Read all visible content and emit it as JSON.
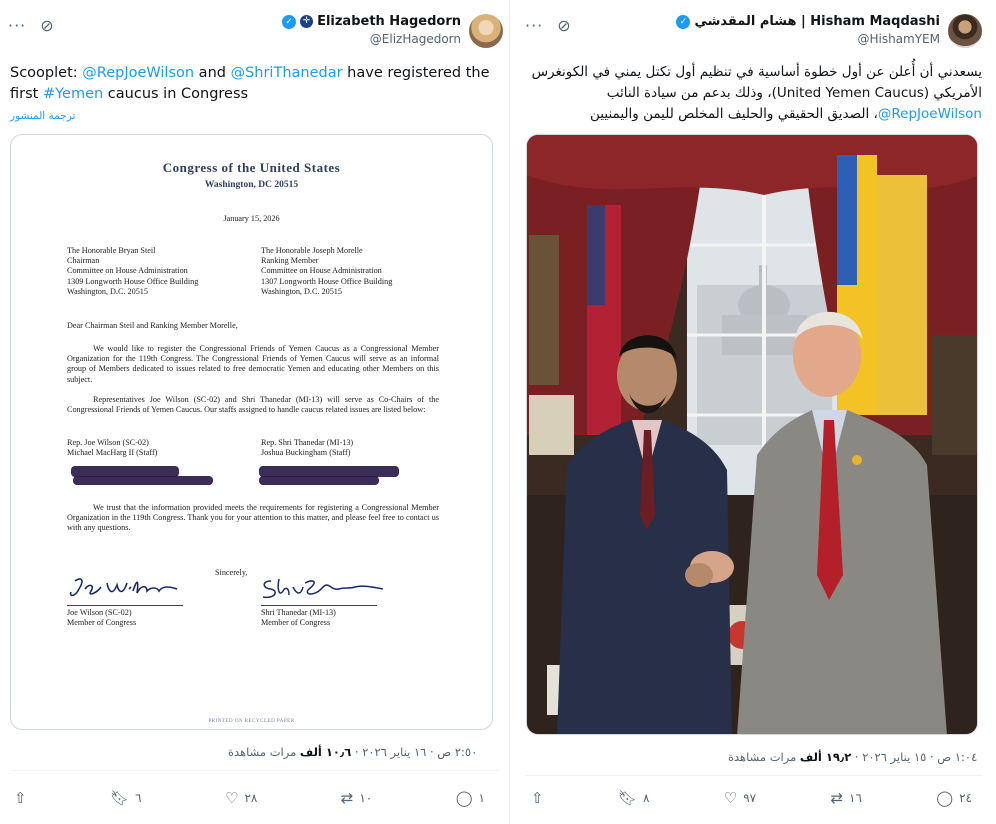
{
  "left": {
    "user": {
      "name": "Elizabeth Hagedorn",
      "handle": "@ElizHagedorn"
    },
    "text": {
      "prefix": "Scooplet: ",
      "mention1": "@RepJoeWilson",
      "mid1": " and ",
      "mention2": "@ShriThanedar",
      "mid2": " have registered the first ",
      "hashtag": "#Yemen",
      "suffix": " caucus in Congress"
    },
    "translate": "ترجمة المنشور",
    "letter": {
      "letterhead": "Congress of the United States",
      "city": "Washington, DC 20515",
      "date": "January 15, 2026",
      "addr1": [
        "The Honorable Bryan Steil",
        "Chairman",
        "Committee on House Administration",
        "1309 Longworth House Office Building",
        "Washington, D.C. 20515"
      ],
      "addr2": [
        "The Honorable Joseph Morelle",
        "Ranking Member",
        "Committee on House Administration",
        "1307 Longworth House Office Building",
        "Washington, D.C. 20515"
      ],
      "greeting": "Dear Chairman Steil and Ranking Member Morelle,",
      "p1": "We would like to register the Congressional Friends of Yemen Caucus as a Congressional Member Organization for the 119th Congress. The Congressional Friends of Yemen Caucus will serve as an informal group of Members dedicated to issues related to free democratic Yemen and educating other Members on this subject.",
      "p2": "Representatives Joe Wilson (SC-02) and Shri Thanedar (MI-13) will serve as Co-Chairs of the Congressional Friends of Yemen Caucus. Our staffs assigned to handle caucus related issues are listed below:",
      "rep1": [
        "Rep. Joe Wilson (SC-02)",
        "Michael MacHarg II (Staff)"
      ],
      "rep2": [
        "Rep. Shri Thanedar (MI-13)",
        "Joshua Buckingham (Staff)"
      ],
      "p3": "We trust that the information provided meets the requirements for registering a Congressional Member Organization in the 119th Congress. Thank you for your attention to this matter, and please feel free to contact us with any questions.",
      "sincerely": "Sincerely,",
      "sign1": [
        "Joe Wilson (SC-02)",
        "Member of Congress"
      ],
      "sign2": [
        "Shri Thanedar (MI-13)",
        "Member of Congress"
      ],
      "footer": "PRINTED ON RECYCLED PAPER"
    },
    "meta": {
      "time": "٢:٥٠ ص · ١٦ يناير ٢٠٢٦ · ",
      "views": "١٠٫٦ ألف",
      "views_label": " مرات مشاهدة"
    },
    "actions": {
      "replies": "١",
      "reposts": "١٠",
      "likes": "٢٨",
      "bookmarks": "٦"
    }
  },
  "right": {
    "user": {
      "name": "هشام المقدشي | Hisham Maqdashi",
      "handle": "@HishamYEM"
    },
    "text": {
      "line": "يسعدني أن أُعلن عن أول خطوة أساسية في تنظيم أول تكتل يمني في الكونغرس الأمريكي (United Yemen Caucus)، وذلك بدعم من سيادة النائب ",
      "mention": "@RepJoeWilson",
      "suffix": "، الصديق الحقيقي والحليف المخلص لليمن واليمنيين"
    },
    "meta": {
      "time": "١:٠٤ ص · ١٥ يناير ٢٠٢٦ · ",
      "views": "١٩٫٢ ألف",
      "views_label": " مرات مشاهدة"
    },
    "actions": {
      "replies": "٢٤",
      "reposts": "١٦",
      "likes": "٩٧",
      "bookmarks": "٨"
    }
  },
  "colors": {
    "link": "#1d9bf0",
    "muted": "#536471",
    "text": "#0f1419"
  }
}
